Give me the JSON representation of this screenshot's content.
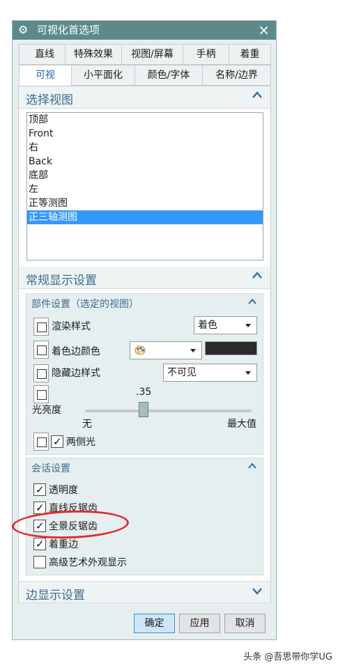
{
  "window": {
    "title": "可视化首选项",
    "close_icon": "×",
    "gear_icon": "⚙"
  },
  "tabs_row1": [
    "直线",
    "特殊效果",
    "视图/屏幕",
    "手柄",
    "着重"
  ],
  "tabs_row2": [
    "可视",
    "小平面化",
    "颜色/字体",
    "名称/边界"
  ],
  "active_tab": "可视",
  "select_view": {
    "title": "选择视图",
    "items": [
      "顶部",
      "Front",
      "右",
      "Back",
      "底部",
      "左",
      "正等测图",
      "正三轴测图"
    ],
    "selected": "正三轴测图"
  },
  "general_display": {
    "title": "常规显示设置",
    "part_settings": {
      "title": "部件设置（选定的视图）",
      "render_style": {
        "label": "渲染样式",
        "value": "着色"
      },
      "shaded_edge_color": {
        "label": "着色边颜色",
        "color": "#2b2b2b",
        "icon": "palette-icon"
      },
      "hidden_edge_style": {
        "label": "隐藏边样式",
        "value": "不可见"
      },
      "brightness": {
        "label": "光亮度",
        "value_text": ".35",
        "value": 0.35,
        "min_label": "无",
        "max_label": "最大值"
      },
      "two_sided_light": {
        "label": "两侧光",
        "checked": true
      }
    },
    "session_settings": {
      "title": "会话设置",
      "items": [
        {
          "label": "透明度",
          "checked": true
        },
        {
          "label": "直线反锯齿",
          "checked": true
        },
        {
          "label": "全景反锯齿",
          "checked": true
        },
        {
          "label": "着重边",
          "checked": true
        },
        {
          "label": "高级艺术外观显示",
          "checked": false
        }
      ]
    }
  },
  "edge_display": {
    "title": "边显示设置"
  },
  "buttons": {
    "ok": "确定",
    "apply": "应用",
    "cancel": "取消"
  },
  "watermark": "头条 @吾思带你学UG",
  "colors": {
    "titlebar": "#5d8a89",
    "selection": "#3399ff",
    "highlight_circle": "#e12b2f"
  }
}
